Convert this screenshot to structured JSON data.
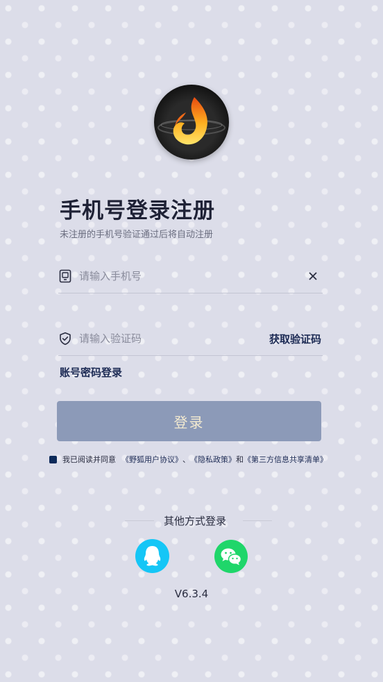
{
  "header": {
    "logo": "flame-logo-icon",
    "title": "手机号登录注册",
    "subtitle": "未注册的手机号验证通过后将自动注册"
  },
  "phone_field": {
    "icon": "phone-icon",
    "placeholder": "请输入手机号",
    "value": "",
    "clear_icon": "close-icon"
  },
  "code_field": {
    "icon": "shield-check-icon",
    "placeholder": "请输入验证码",
    "value": "",
    "get_code_label": "获取验证码"
  },
  "password_login_label": "账号密码登录",
  "login_button_label": "登录",
  "agreement": {
    "checked": true,
    "prefix": "我已阅读并同意",
    "user_agreement": "《野狐用户协议》",
    "separator": "、",
    "privacy_policy": "《隐私政策》",
    "and": "和",
    "third_party_list": "《第三方信息共享清单》"
  },
  "other_login": {
    "label": "其他方式登录",
    "options": [
      {
        "name": "QQ",
        "icon": "qq-icon",
        "color": "#15c6f6"
      },
      {
        "name": "WeChat",
        "icon": "wechat-icon",
        "color": "#1fd66a"
      }
    ]
  },
  "version": "V6.3.4",
  "colors": {
    "background": "#dcdde9",
    "accent": "#1d2b55",
    "login_button": "#8c9ab8",
    "login_button_text": "#f3ead0"
  }
}
